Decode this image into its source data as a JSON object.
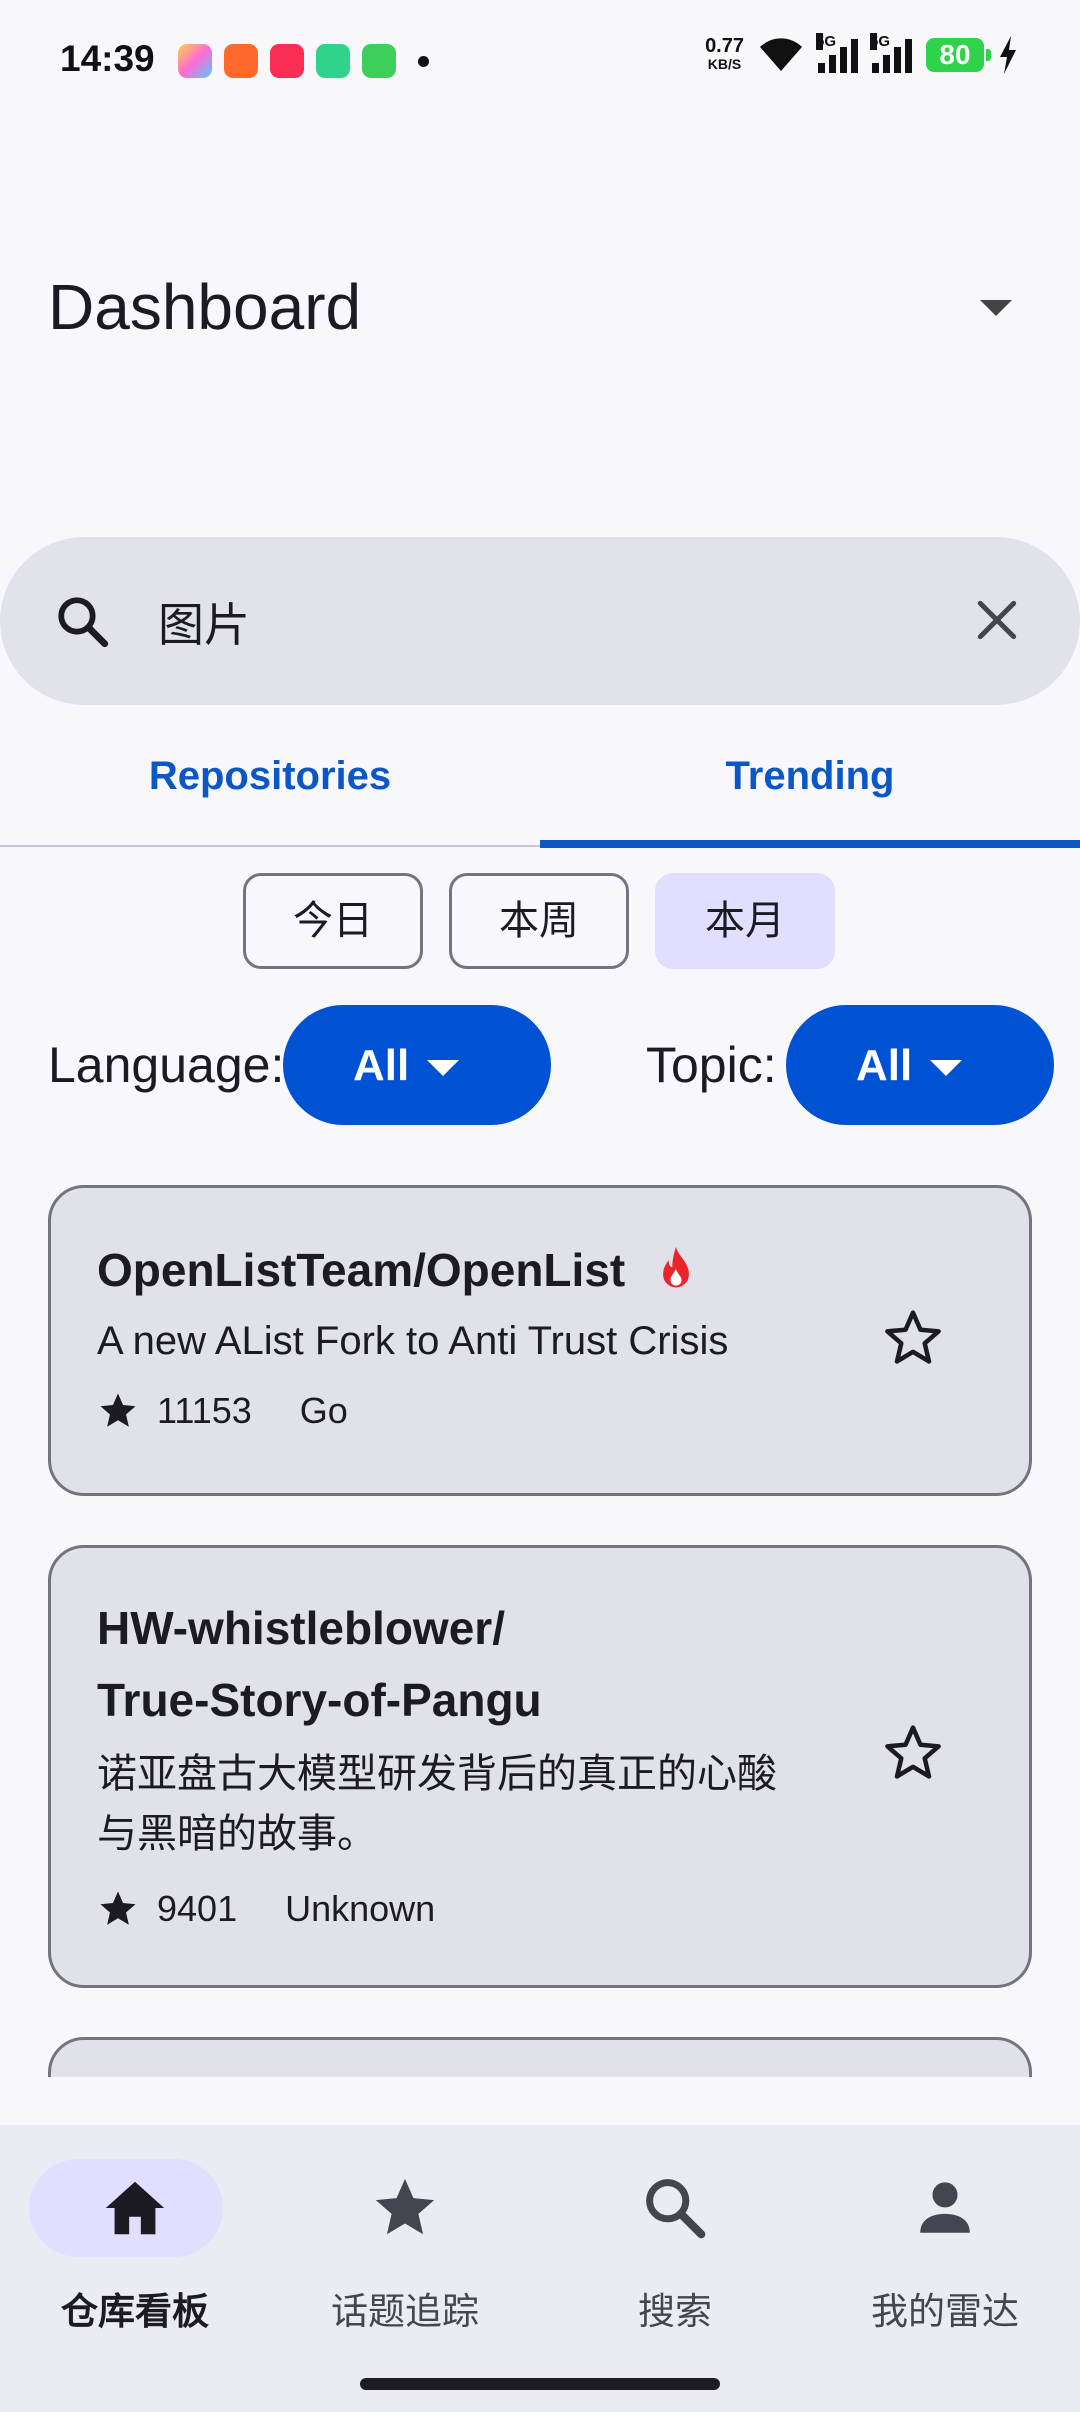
{
  "status_bar": {
    "time": "14:39",
    "net_speed_value": "0.77",
    "net_speed_unit": "KB/S",
    "signal_1": "5G",
    "signal_2": "5G",
    "battery": "80"
  },
  "header": {
    "title": "Dashboard"
  },
  "search": {
    "query": "图片"
  },
  "tabs": [
    {
      "label": "Repositories"
    },
    {
      "label": "Trending"
    }
  ],
  "active_tab": "Trending",
  "periods": [
    {
      "label": "今日"
    },
    {
      "label": "本周"
    },
    {
      "label": "本月"
    }
  ],
  "selected_period": "本月",
  "filters": {
    "language_label": "Language:",
    "language_value": "All",
    "topic_label": "Topic:",
    "topic_value": "All"
  },
  "repos": [
    {
      "name": "OpenListTeam/OpenList",
      "description": "A new AList Fork to Anti Trust Crisis",
      "stars": "11153",
      "language": "Go",
      "hot": true
    },
    {
      "name_line1": "HW-whistleblower/",
      "name_line2": "True-Story-of-Pangu",
      "description_line1": "诺亚盘古大模型研发背后的真正的心酸",
      "description_line2": "与黑暗的故事。",
      "stars": "9401",
      "language": "Unknown",
      "hot": false
    }
  ],
  "bottom_nav": [
    {
      "label": "仓库看板",
      "icon": "home-icon"
    },
    {
      "label": "话题追踪",
      "icon": "star-icon"
    },
    {
      "label": "搜索",
      "icon": "search-icon"
    },
    {
      "label": "我的雷达",
      "icon": "person-icon"
    }
  ],
  "colors": {
    "primary": "#0b57c6",
    "filter_button": "#0052d4",
    "selected_chip": "#e1dfff",
    "card_bg": "#e1e1ea",
    "hot_icon": "#e8262a"
  }
}
